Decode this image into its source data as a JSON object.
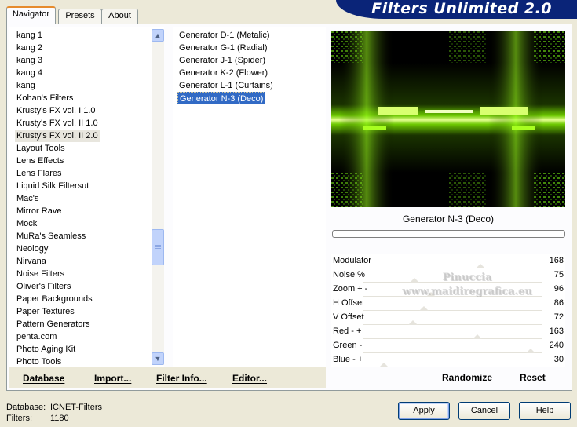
{
  "app": {
    "title": "Filters Unlimited 2.0"
  },
  "tabs": [
    "Navigator",
    "Presets",
    "About"
  ],
  "categories": [
    "kang 1",
    "kang 2",
    "kang 3",
    "kang 4",
    "kang",
    "Kohan's Filters",
    "Krusty's FX vol. I 1.0",
    "Krusty's FX vol. II 1.0",
    "Krusty's FX vol. II 2.0",
    "Layout Tools",
    "Lens Effects",
    "Lens Flares",
    "Liquid Silk Filtersut",
    "Mac's",
    "Mirror Rave",
    "Mock",
    "MuRa's Seamless",
    "Neology",
    "Nirvana",
    "Noise Filters",
    "Oliver's Filters",
    "Paper Backgrounds",
    "Paper Textures",
    "Pattern Generators",
    "penta.com",
    "Photo Aging Kit",
    "Photo Tools"
  ],
  "selected_category": "Krusty's FX vol. II 2.0",
  "filters": [
    "Generator D-1 (Metalic)",
    "Generator G-1 (Radial)",
    "Generator J-1 (Spider)",
    "Generator K-2 (Flower)",
    "Generator L-1 (Curtains)",
    "Generator N-3 (Deco)"
  ],
  "selected_filter": "Generator N-3 (Deco)",
  "links": {
    "database": "Database",
    "import": "Import...",
    "filter_info": "Filter Info...",
    "editor": "Editor..."
  },
  "preview": {
    "filter_name": "Generator N-3 (Deco)",
    "progress": 0
  },
  "controls": [
    {
      "label": "Modulator",
      "value": "168",
      "level": 0.66
    },
    {
      "label": "Noise %",
      "value": "75",
      "level": 0.29
    },
    {
      "label": "Zoom + -",
      "value": "96",
      "level": 0.38
    },
    {
      "label": "H Offset",
      "value": "86",
      "level": 0.34
    },
    {
      "label": "V Offset",
      "value": "72",
      "level": 0.28
    },
    {
      "label": "Red - +",
      "value": "163",
      "level": 0.64
    },
    {
      "label": "Green - +",
      "value": "240",
      "level": 0.94
    },
    {
      "label": "Blue - +",
      "value": "30",
      "level": 0.12
    }
  ],
  "actions": {
    "randomize": "Randomize",
    "reset": "Reset"
  },
  "status": {
    "database_label": "Database:",
    "database_value": "ICNET-Filters",
    "filters_label": "Filters:",
    "filters_value": "1180"
  },
  "buttons": {
    "apply": "Apply",
    "cancel": "Cancel",
    "help": "Help"
  },
  "watermark": {
    "line1": "Pinuccia",
    "line2": "www.maidiregrafica.eu"
  },
  "colors": {
    "banner": "#0a2478",
    "selection": "#316ac5",
    "glow": "#a8ff20"
  }
}
